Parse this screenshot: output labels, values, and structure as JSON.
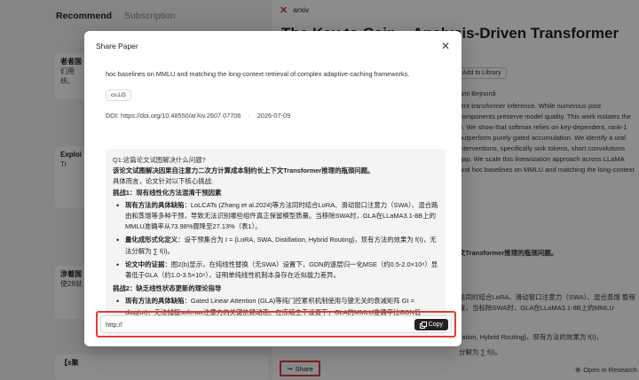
{
  "background": {
    "tabs": {
      "recommend": "Recommend",
      "subscription": "Subscription"
    },
    "left_cards": [
      {
        "line1": "者者国",
        "line2": "们用",
        "line3": "统、"
      },
      {
        "line1": "Exploi",
        "line2": "Tr",
        "line3": ""
      },
      {
        "line1": "涉着国",
        "line2": "使28就",
        "line3": ""
      },
      {
        "line1": "【s聚",
        "line2": "",
        "line3": ""
      }
    ],
    "source": "arxiv",
    "paper_title": "The Key to Gain... Analysis-Driven Transformer",
    "add_to_library": "Add to Library",
    "author": "ami Bejnordi",
    "abstract_right": "lent transformer inference. While numerous post components preserve model quality. This work isolates the e. We show that softmax relies on key-dependent, rank-1 outperform purely gated accumulation. We identify a ural interventions, specifically sink tokens, short convolutions gap. We scale this linearization approach across LLaMA and hoc baselines on MMLU and matching the long-context",
    "right_lower_1": "文Transformer推理的瓶颈问题。",
    "right_lower_2": "法同时结合LoRA、滑动窗口注意力（SWA）、混合蒸馏 整程度。当标除SWA时，GLA在LLaMA3.1-8B上的MMLU",
    "right_lower_3": "ilation, Hybrid Routing}，现有方法的效果为 f(I)，",
    "right_lower_4": "分解为 ∑ f(i)。",
    "share_label": "Share",
    "open_research": "Open in Research"
  },
  "modal": {
    "title": "Share Paper",
    "abstract_tail": "hoc baselines on MMLU and matching the long-context retrieval of complex adaptive-caching frameworks.",
    "category": "cs.LG",
    "doi": "DOI: https://doi.org/10.48550/arXiv.2607.07706",
    "date": "2026-07-09",
    "qa": {
      "q1": "Q1:这篇论文试图解决什么问题?",
      "answer_lead": "该论文试图解决因果自注意力二次方计算成本制约长上下文Transformer推理的瓶颈问题。",
      "intro": "具体而言，论文针对以下核心挑战:",
      "challenge1": "挑战1：现有线性化方法混淆干预因素",
      "c1_b1_label": "现有方法的具体缺陷",
      "c1_b1_text": "：LoLCATs (Zhang et al.2024)等方法同时结合LoRA、滑动窗口注意力（SWA）、混合路由和蒸馏等多种干预，导致无法识别哪些组件真正保留模型质量。当移除SWA时，GLA在LLaMA3.1-8B上的MMLU准确率从73.98%骤降至27.13%（表1）。",
      "c1_b2_label": "量化成形式化定义",
      "c1_b2_text": "：设干预集合为 I = {LoRA, SWA, Distillation, Hybrid Routing}，现有方法的效果为 f(I)，无法分解为 ∑ f(i)。",
      "c1_b3_label": "论文中的证据",
      "c1_b3_text": "：图2(b)显示，在纯线性替换（无SWA）设置下，GDN的逐层归一化MSE（约0.5-2.0×10⁸）显著低于GLA（约1.0-3.5×10⁸），证明单纯线性机制本身存在近似能力差异。",
      "challenge2": "挑战2：缺乏线性状态更新的理论指导",
      "c2_b1_label": "现有方法的具体缺陷",
      "c2_b1_text": "：Gated Linear Attention (GLA)等纯门控累积机制使用与键无关的衰减矩阵 Gt = diag(αt)，无法捕捉softmax注意力的关键依赖动态。在冻结主干设置下，GLA的MMLU准确率比GDN低"
    },
    "share_url": "http://",
    "copy_label": "Copy"
  }
}
